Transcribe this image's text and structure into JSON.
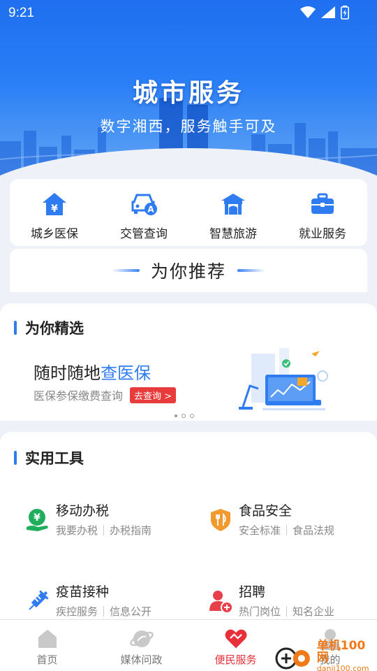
{
  "status": {
    "time": "9:21"
  },
  "hero": {
    "title": "城市服务",
    "subtitle": "数字湘西，服务触手可及"
  },
  "quick_links": [
    {
      "label": "城乡医保",
      "icon": "medical-insurance-icon"
    },
    {
      "label": "交管查询",
      "icon": "car-icon"
    },
    {
      "label": "智慧旅游",
      "icon": "pavilion-icon"
    },
    {
      "label": "就业服务",
      "icon": "briefcase-icon"
    }
  ],
  "recommend": {
    "title": "为你推荐"
  },
  "picks": {
    "heading": "为你精选",
    "banner_title_prefix": "随时随地",
    "banner_title_highlight": "查医保",
    "banner_subtitle": "医保参保缴费查询",
    "banner_button": "去查询 >"
  },
  "tools": {
    "heading": "实用工具",
    "items": [
      {
        "name": "移动办税",
        "links": [
          "我要办税",
          "办税指南"
        ],
        "icon": "tax-icon"
      },
      {
        "name": "食品安全",
        "links": [
          "安全标准",
          "食品法规"
        ],
        "icon": "food-safety-shield-icon"
      },
      {
        "name": "疫苗接种",
        "links": [
          "疾控服务",
          "信息公开"
        ],
        "icon": "vaccine-syringe-icon"
      },
      {
        "name": "招聘",
        "links": [
          "热门岗位",
          "知名企业"
        ],
        "icon": "recruit-person-icon"
      }
    ]
  },
  "nav": [
    {
      "label": "首页",
      "icon": "home-icon"
    },
    {
      "label": "媒体问政",
      "icon": "planet-icon"
    },
    {
      "label": "便民服务",
      "icon": "heart-hands-icon",
      "active": true
    },
    {
      "label": "我的",
      "icon": "person-icon"
    }
  ],
  "watermark": {
    "line1": "单机100网",
    "line2": "danji100.com"
  },
  "colors": {
    "primary": "#2f7bf0",
    "active_red": "#e8303a",
    "badge_red": "#e83b3b"
  }
}
